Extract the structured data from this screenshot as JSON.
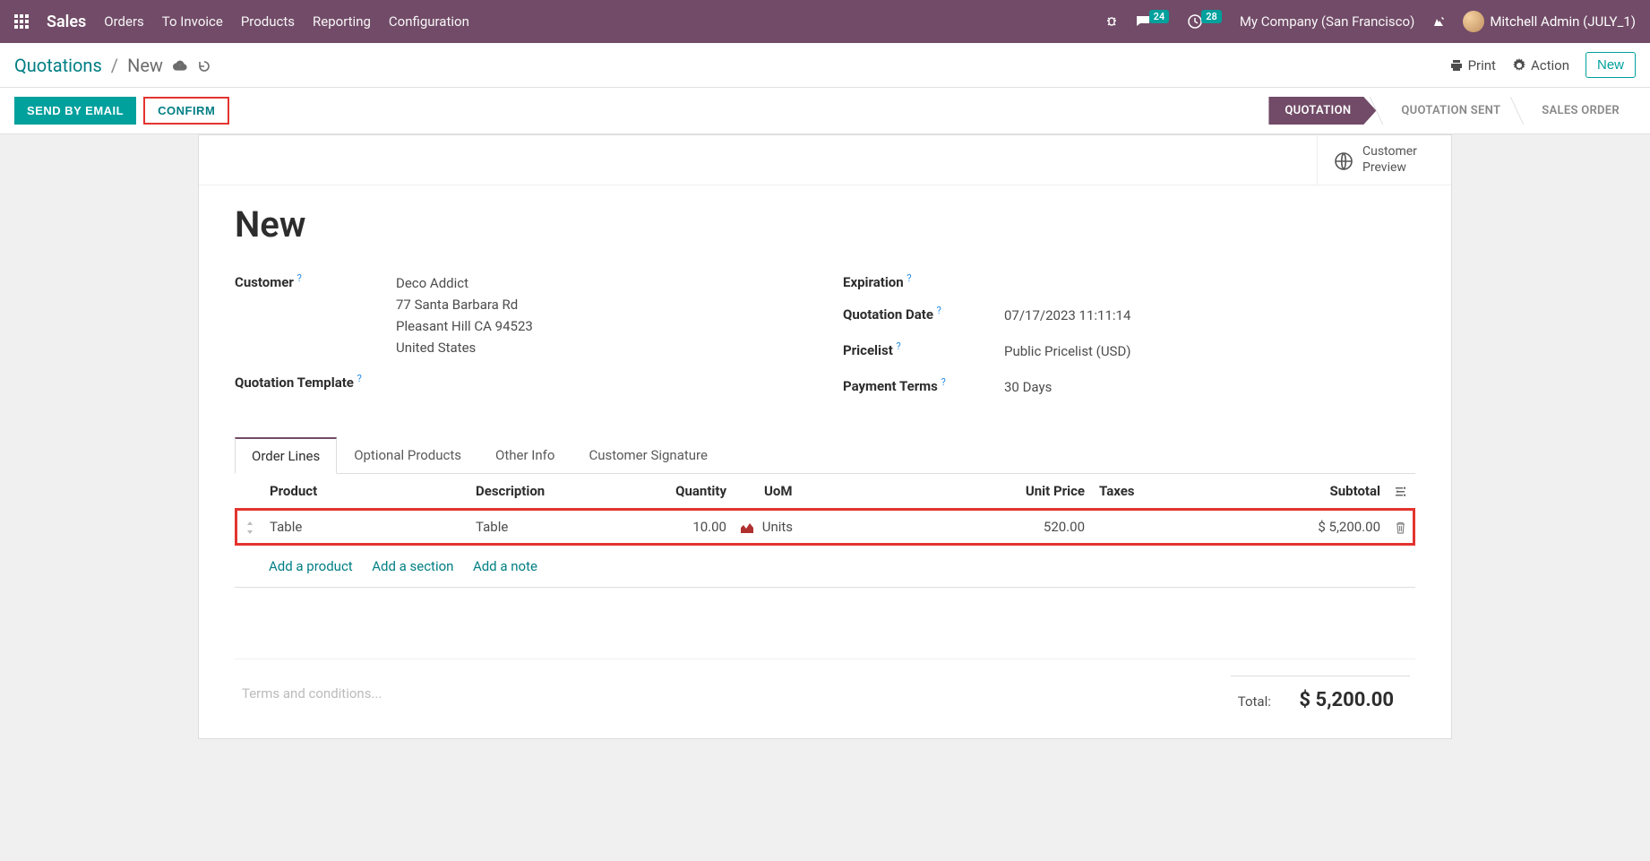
{
  "navbar": {
    "app_title": "Sales",
    "menu": [
      "Orders",
      "To Invoice",
      "Products",
      "Reporting",
      "Configuration"
    ],
    "messages_badge": "24",
    "clock_badge": "28",
    "company": "My Company (San Francisco)",
    "user": "Mitchell Admin (JULY_1)"
  },
  "control_panel": {
    "breadcrumb_root": "Quotations",
    "breadcrumb_current": "New",
    "print_label": "Print",
    "action_label": "Action",
    "new_label": "New"
  },
  "status_buttons": {
    "send_email": "SEND BY EMAIL",
    "confirm": "CONFIRM"
  },
  "statusbar": {
    "steps": [
      "QUOTATION",
      "QUOTATION SENT",
      "SALES ORDER"
    ]
  },
  "stat_button": {
    "line1": "Customer",
    "line2": "Preview"
  },
  "form": {
    "title": "New",
    "labels": {
      "customer": "Customer",
      "quotation_template": "Quotation Template",
      "expiration": "Expiration",
      "quotation_date": "Quotation Date",
      "pricelist": "Pricelist",
      "payment_terms": "Payment Terms"
    },
    "customer": {
      "name": "Deco Addict",
      "street": "77 Santa Barbara Rd",
      "city_line": "Pleasant Hill CA 94523",
      "country": "United States"
    },
    "quotation_date": "07/17/2023 11:11:14",
    "pricelist": "Public Pricelist (USD)",
    "payment_terms": "30 Days"
  },
  "tabs": [
    "Order Lines",
    "Optional Products",
    "Other Info",
    "Customer Signature"
  ],
  "table": {
    "headers": {
      "product": "Product",
      "description": "Description",
      "quantity": "Quantity",
      "uom": "UoM",
      "unit_price": "Unit Price",
      "taxes": "Taxes",
      "subtotal": "Subtotal"
    },
    "row": {
      "product": "Table",
      "description": "Table",
      "quantity": "10.00",
      "uom": "Units",
      "unit_price": "520.00",
      "subtotal": "$ 5,200.00"
    },
    "add_product": "Add a product",
    "add_section": "Add a section",
    "add_note": "Add a note"
  },
  "footer": {
    "terms_placeholder": "Terms and conditions...",
    "total_label": "Total:",
    "total_value": "$ 5,200.00"
  }
}
